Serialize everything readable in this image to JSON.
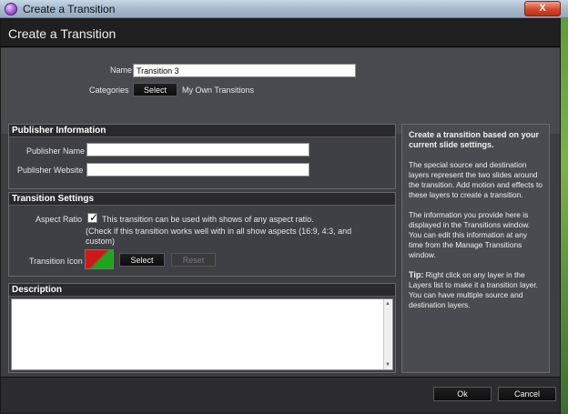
{
  "os_window": {
    "title": "Create a Transition",
    "close_glyph": "X"
  },
  "header": {
    "title": "Create a Transition"
  },
  "top": {
    "name_label": "Name",
    "name_value": "Transition 3",
    "categories_label": "Categories",
    "categories_button": "Select",
    "categories_value": "My Own Transitions"
  },
  "publisher": {
    "heading": "Publisher Information",
    "name_label": "Publisher Name",
    "name_value": "",
    "website_label": "Publisher Website",
    "website_value": ""
  },
  "settings": {
    "heading": "Transition Settings",
    "aspect_label": "Aspect Ratio",
    "aspect_checked": true,
    "aspect_text": "This transition can be used with shows of any aspect ratio.",
    "aspect_subtext": "(Check if this transition works well with in all show aspects (16:9, 4:3, and custom)",
    "icon_label": "Transition Icon",
    "select_button": "Select",
    "reset_button": "Reset"
  },
  "description": {
    "heading": "Description",
    "value": ""
  },
  "tip": {
    "intro": "Create a transition based on your current slide settings.",
    "p1": "The special source and destination layers represent the two slides around the transition. Add motion and effects to these layers to create a transition.",
    "p2": "The information you provide here is displayed in the Transitions window. You can edit this information at any time from the Manage Transitions window.",
    "p3_label": "Tip:",
    "p3": " Right click on any layer in the Layers list to make it a transition layer. You can have multiple source and destination layers."
  },
  "footer": {
    "ok_button": "Ok",
    "cancel_button": "Cancel"
  },
  "colors": {
    "panel_bg": "#3f4045",
    "header_bg": "#1f1f1f",
    "tip_bg": "#4a4b50"
  }
}
